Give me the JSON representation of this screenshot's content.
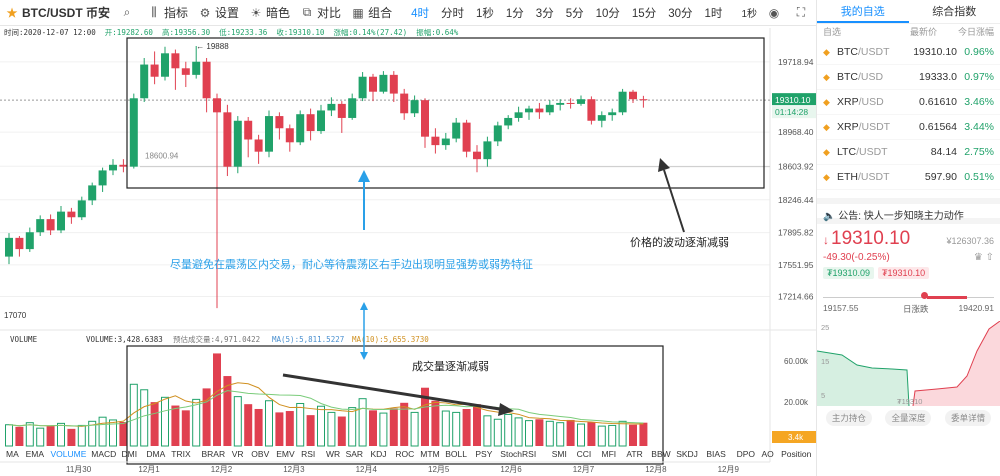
{
  "toolbar": {
    "symbol": "BTC/USDT 币安",
    "indicator": "指标",
    "settings": "设置",
    "dark": "暗色",
    "compare": "对比",
    "combine": "组合",
    "timeframes": [
      "4时",
      "分时",
      "1秒",
      "1分",
      "3分",
      "5分",
      "10分",
      "15分",
      "30分",
      "1时"
    ],
    "active_tf": "4时",
    "seconds_label": "1秒"
  },
  "infobar": {
    "time": "时间:2020-12-07 12:00",
    "open": "开:19282.60",
    "high": "高:19356.30",
    "low": "低:19233.36",
    "close": "收:19310.10",
    "change": "涨幅:0.14%(27.42)",
    "amplitude": "振幅:0.64%"
  },
  "chart_data": {
    "type": "candlestick",
    "symbol": "BTC/USDT",
    "interval": "4h",
    "x_tick_labels": [
      "11月30",
      "12月1",
      "12月2",
      "12月3",
      "12月4",
      "12月5",
      "12月6",
      "12月7",
      "12月8",
      "12月9"
    ],
    "y_tick_labels": [
      "19718.94",
      "18968.40",
      "18603.92",
      "18246.44",
      "17895.82",
      "17551.95",
      "17214.66"
    ],
    "y_range": [
      17070,
      19888
    ],
    "last_price": "19310.10",
    "countdown": "01:14:28",
    "high_marker": "19888",
    "low_marker": "17070",
    "range_line_label": "18600.94",
    "candles": [
      [
        17640,
        17840,
        17560,
        17890
      ],
      [
        17840,
        17720,
        17640,
        17860
      ],
      [
        17720,
        17900,
        17690,
        17950
      ],
      [
        17900,
        18040,
        17860,
        18080
      ],
      [
        18040,
        17920,
        17870,
        18090
      ],
      [
        17920,
        18120,
        17890,
        18180
      ],
      [
        18120,
        18060,
        17990,
        18160
      ],
      [
        18060,
        18240,
        18030,
        18280
      ],
      [
        18240,
        18400,
        18190,
        18430
      ],
      [
        18400,
        18560,
        18330,
        18590
      ],
      [
        18560,
        18620,
        18510,
        18680
      ],
      [
        18620,
        18600,
        18540,
        18680
      ],
      [
        18600,
        19330,
        18580,
        19380
      ],
      [
        19330,
        19690,
        19290,
        19760
      ],
      [
        19690,
        19560,
        19480,
        19830
      ],
      [
        19560,
        19810,
        19520,
        19880
      ],
      [
        19810,
        19650,
        19420,
        19850
      ],
      [
        19650,
        19580,
        19450,
        19720
      ],
      [
        19580,
        19720,
        19540,
        19888
      ],
      [
        19720,
        19330,
        19180,
        19760
      ],
      [
        19330,
        19180,
        17090,
        19380
      ],
      [
        19180,
        18600,
        18500,
        19260
      ],
      [
        18600,
        19090,
        18530,
        19140
      ],
      [
        19090,
        18890,
        18700,
        19130
      ],
      [
        18890,
        18760,
        18630,
        18940
      ],
      [
        18760,
        19140,
        18700,
        19200
      ],
      [
        19140,
        19010,
        18890,
        19180
      ],
      [
        19010,
        18860,
        18760,
        19050
      ],
      [
        18860,
        19160,
        18830,
        19200
      ],
      [
        19160,
        18980,
        18880,
        19220
      ],
      [
        18980,
        19200,
        18950,
        19260
      ],
      [
        19200,
        19270,
        19140,
        19340
      ],
      [
        19270,
        19120,
        18960,
        19300
      ],
      [
        19120,
        19330,
        19100,
        19380
      ],
      [
        19330,
        19560,
        19300,
        19610
      ],
      [
        19560,
        19400,
        19300,
        19590
      ],
      [
        19400,
        19580,
        19380,
        19620
      ],
      [
        19580,
        19380,
        19290,
        19620
      ],
      [
        19380,
        19170,
        19100,
        19430
      ],
      [
        19170,
        19310,
        19130,
        19360
      ],
      [
        19310,
        18920,
        18800,
        19330
      ],
      [
        18920,
        18830,
        18740,
        19010
      ],
      [
        18830,
        18900,
        18780,
        18960
      ],
      [
        18900,
        19070,
        18860,
        19120
      ],
      [
        19070,
        18760,
        18700,
        19100
      ],
      [
        18760,
        18680,
        18540,
        18830
      ],
      [
        18680,
        18870,
        18600,
        18920
      ],
      [
        18870,
        19040,
        18820,
        19080
      ],
      [
        19040,
        19120,
        19000,
        19150
      ],
      [
        19120,
        19180,
        19080,
        19240
      ],
      [
        19180,
        19220,
        19100,
        19250
      ],
      [
        19220,
        19180,
        19110,
        19280
      ],
      [
        19180,
        19260,
        19150,
        19310
      ],
      [
        19260,
        19280,
        19200,
        19320
      ],
      [
        19280,
        19270,
        19220,
        19330
      ],
      [
        19270,
        19320,
        19250,
        19360
      ],
      [
        19320,
        19090,
        19050,
        19350
      ],
      [
        19090,
        19150,
        19020,
        19190
      ],
      [
        19150,
        19180,
        19090,
        19220
      ],
      [
        19180,
        19400,
        19150,
        19430
      ],
      [
        19400,
        19320,
        19280,
        19420
      ],
      [
        19320,
        19310,
        19230,
        19356
      ]
    ],
    "volume_panel": {
      "title": "VOLUME",
      "value": "VOLUME:3,428.6383",
      "estimate": "预估成交量:4,971.0422",
      "ma5": "MA(5):5,811.5227",
      "ma10": "MA(10):5,655.3730",
      "y_ticks": [
        "60.00k",
        "20.00k"
      ],
      "last": "3.4k",
      "values": [
        3.1,
        2.8,
        3.4,
        2.6,
        2.9,
        3.3,
        2.5,
        3.0,
        3.6,
        4.2,
        3.8,
        3.5,
        9.0,
        8.2,
        6.4,
        7.1,
        5.9,
        5.2,
        6.8,
        8.4,
        13.5,
        10.2,
        7.2,
        6.1,
        5.4,
        6.6,
        4.9,
        5.1,
        6.2,
        4.5,
        5.8,
        4.9,
        4.3,
        5.6,
        6.9,
        5.2,
        4.8,
        5.5,
        6.3,
        4.9,
        8.5,
        6.6,
        5.1,
        4.9,
        5.4,
        6.1,
        4.4,
        3.9,
        4.6,
        4.1,
        3.7,
        3.9,
        3.6,
        3.4,
        3.8,
        3.2,
        3.5,
        2.9,
        3.0,
        3.6,
        3.1,
        3.4
      ]
    },
    "annotations": {
      "consolidation_note": "尽量避免在震荡区内交易，耐心等待震荡区右手边出现明显强势或弱势特征",
      "volatility_note": "价格的波动逐渐减弱",
      "volume_note": "成交量逐渐减弱"
    },
    "indicator_tabs": [
      "MA",
      "EMA",
      "VOLUME",
      "MACD",
      "DMI",
      "DMA",
      "TRIX",
      "BRAR",
      "VR",
      "OBV",
      "EMV",
      "RSI",
      "WR",
      "SAR",
      "KDJ",
      "ROC",
      "MTM",
      "BOLL",
      "PSY",
      "StochRSI",
      "SMI",
      "CCI",
      "MFI",
      "ATR",
      "BBW",
      "SKDJ",
      "BIAS",
      "DPO",
      "AO",
      "Position"
    ],
    "active_indicator": "VOLUME"
  },
  "panel": {
    "tab_watch": "我的自选",
    "tab_index": "综合指数",
    "col_pair": "自选",
    "col_last": "最新价",
    "col_change": "今日涨幅",
    "watchlist": [
      {
        "base": "BTC",
        "quote": "/USDT",
        "last": "19310.10",
        "change": "0.96%"
      },
      {
        "base": "BTC",
        "quote": "/USD",
        "last": "19333.0",
        "change": "0.97%"
      },
      {
        "base": "XRP",
        "quote": "/USD",
        "last": "0.61610",
        "change": "3.46%"
      },
      {
        "base": "XRP",
        "quote": "/USDT",
        "last": "0.61564",
        "change": "3.44%"
      },
      {
        "base": "LTC",
        "quote": "/USDT",
        "last": "84.14",
        "change": "2.75%"
      },
      {
        "base": "ETH",
        "quote": "/USDT",
        "last": "597.90",
        "change": "0.51%"
      }
    ],
    "notice": "公告: 快人一步知晓主力动作",
    "price": "19310.10",
    "price_cny": "¥126307.36",
    "change": "-49.30(-0.25%)",
    "bid": "₮19310.09",
    "ask": "₮19310.10",
    "range_low": "19157.55",
    "range_high": "19420.91",
    "range_label": "日涨跌",
    "depth_ticks": [
      "25",
      "15",
      "5"
    ],
    "depth_mid": "₮19310",
    "depth_buttons": [
      "主力持仓",
      "全量深度",
      "委单详情"
    ]
  },
  "colors": {
    "up": "#20a26a",
    "down": "#e04050",
    "accent": "#1890ff",
    "annot_arrow": "#2aa0e8"
  }
}
